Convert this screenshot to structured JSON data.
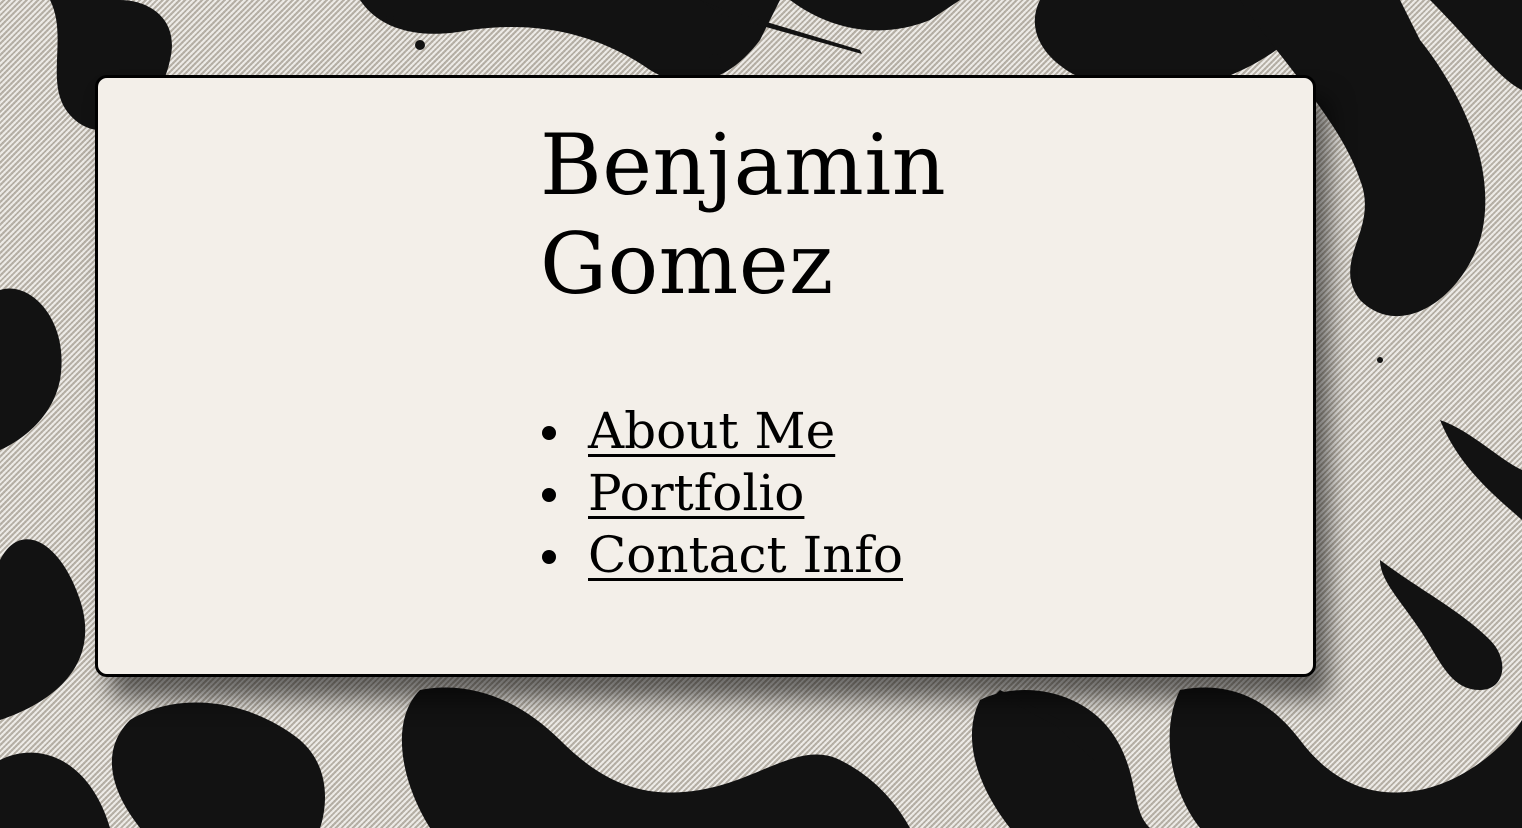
{
  "page": {
    "title_lines": [
      "Benjamin",
      "Gomez"
    ]
  },
  "nav": {
    "items": [
      {
        "label": "About Me"
      },
      {
        "label": "Portfolio"
      },
      {
        "label": "Contact Info"
      }
    ]
  },
  "colors": {
    "card_background": "#f3efe9",
    "text": "#000000",
    "ink": "#111111",
    "canvas": "#d9d4cb"
  }
}
